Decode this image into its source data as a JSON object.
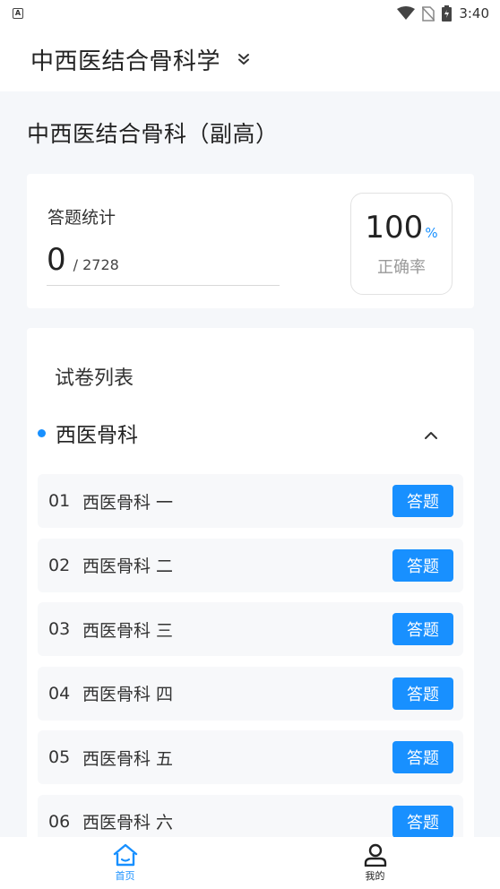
{
  "status": {
    "time": "3:40",
    "indicator": "A"
  },
  "header": {
    "title": "中西医结合骨科学"
  },
  "subject": {
    "title": "中西医结合骨科（副高）"
  },
  "stats": {
    "label": "答题统计",
    "answered": "0",
    "total": "/ 2728",
    "rate": "100",
    "rate_unit": "%",
    "rate_label": "正确率"
  },
  "papers": {
    "title": "试卷列表",
    "group": "西医骨科",
    "button_label": "答题",
    "items": [
      {
        "num": "01",
        "name": "西医骨科 一"
      },
      {
        "num": "02",
        "name": "西医骨科 二"
      },
      {
        "num": "03",
        "name": "西医骨科 三"
      },
      {
        "num": "04",
        "name": "西医骨科 四"
      },
      {
        "num": "05",
        "name": "西医骨科 五"
      },
      {
        "num": "06",
        "name": "西医骨科 六"
      }
    ]
  },
  "tabbar": {
    "home": "首页",
    "mine": "我的"
  },
  "colors": {
    "accent": "#1890ff",
    "background": "#f5f7fa"
  }
}
